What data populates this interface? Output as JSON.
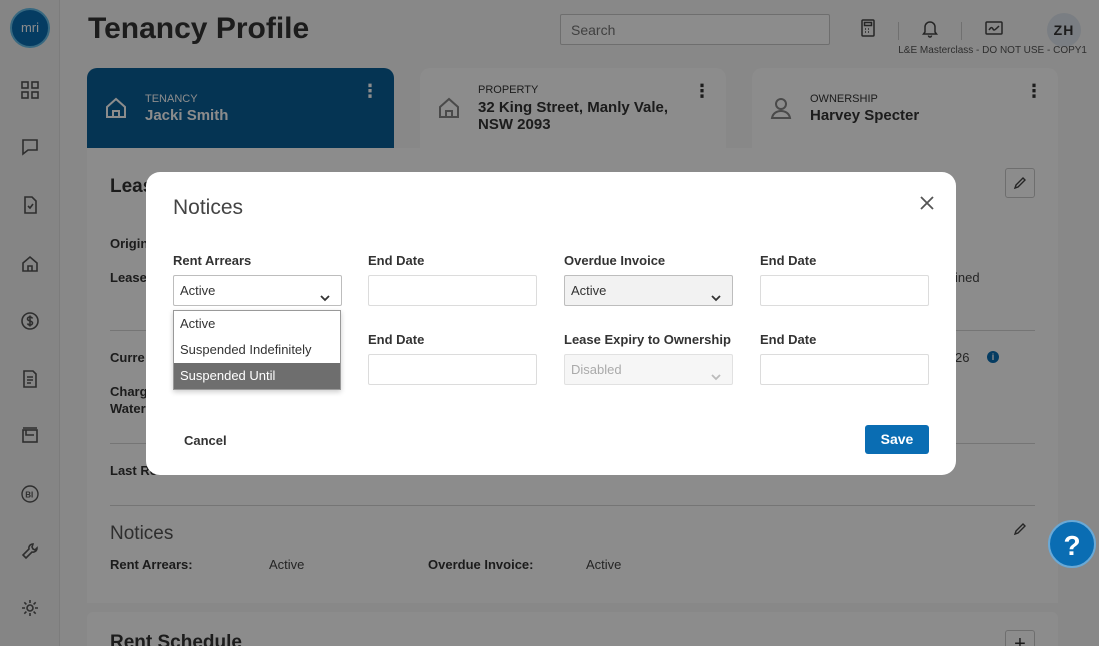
{
  "app": {
    "logo_text": "mri"
  },
  "sidebar": {
    "items": [
      {
        "icon": "dashboard-icon"
      },
      {
        "icon": "chat-icon"
      },
      {
        "icon": "document-check-icon"
      },
      {
        "icon": "home-icon"
      },
      {
        "icon": "dollar-icon"
      },
      {
        "icon": "report-icon"
      },
      {
        "icon": "inbox-icon"
      },
      {
        "icon": "bi-icon"
      },
      {
        "icon": "wrench-icon"
      },
      {
        "icon": "settings-icon"
      }
    ]
  },
  "header": {
    "title": "Tenancy Profile",
    "search_placeholder": "Search",
    "avatar_initials": "ZH",
    "env_label": "L&E Masterclass - DO NOT USE - COPY1"
  },
  "tabs": [
    {
      "label": "TENANCY",
      "value": "Jacki Smith",
      "icon": "home-icon"
    },
    {
      "label": "PROPERTY",
      "value_line1": "32 King Street, Manly Vale,",
      "value_line2": "NSW 2093",
      "icon": "home-icon"
    },
    {
      "label": "OWNERSHIP",
      "value": "Harvey Specter",
      "icon": "person-icon"
    }
  ],
  "background": {
    "lease_heading": "Leas",
    "orig_label": "Origin",
    "lease_label": "Lease",
    "expired_text": "ined",
    "curr_label": "Curre",
    "curr_value": "26",
    "charg_label": "Charg",
    "water_label": "Water",
    "last_label": "Last Re",
    "notices_heading": "Notices",
    "rent_arrears_label": "Rent Arrears:",
    "rent_arrears_value": "Active",
    "overdue_invoice_label": "Overdue Invoice:",
    "overdue_invoice_value": "Active",
    "rent_schedule_heading": "Rent Schedule"
  },
  "modal": {
    "title": "Notices",
    "rent_arrears": {
      "label": "Rent Arrears",
      "value": "Active",
      "options": [
        "Active",
        "Suspended Indefinitely",
        "Suspended Until"
      ],
      "highlighted": "Suspended Until"
    },
    "end_date_1": {
      "label": "End Date",
      "value": ""
    },
    "overdue_invoice": {
      "label": "Overdue Invoice",
      "value": "Active"
    },
    "end_date_2": {
      "label": "End Date",
      "value": ""
    },
    "end_date_3": {
      "label": "End Date",
      "value": ""
    },
    "lease_expiry": {
      "label": "Lease Expiry to Ownership",
      "value": "Disabled"
    },
    "end_date_4": {
      "label": "End Date",
      "value": ""
    },
    "cancel_label": "Cancel",
    "save_label": "Save"
  },
  "help": {
    "label": "?"
  },
  "colors": {
    "accent": "#0a6db3",
    "tab_active": "#0a5f98"
  }
}
